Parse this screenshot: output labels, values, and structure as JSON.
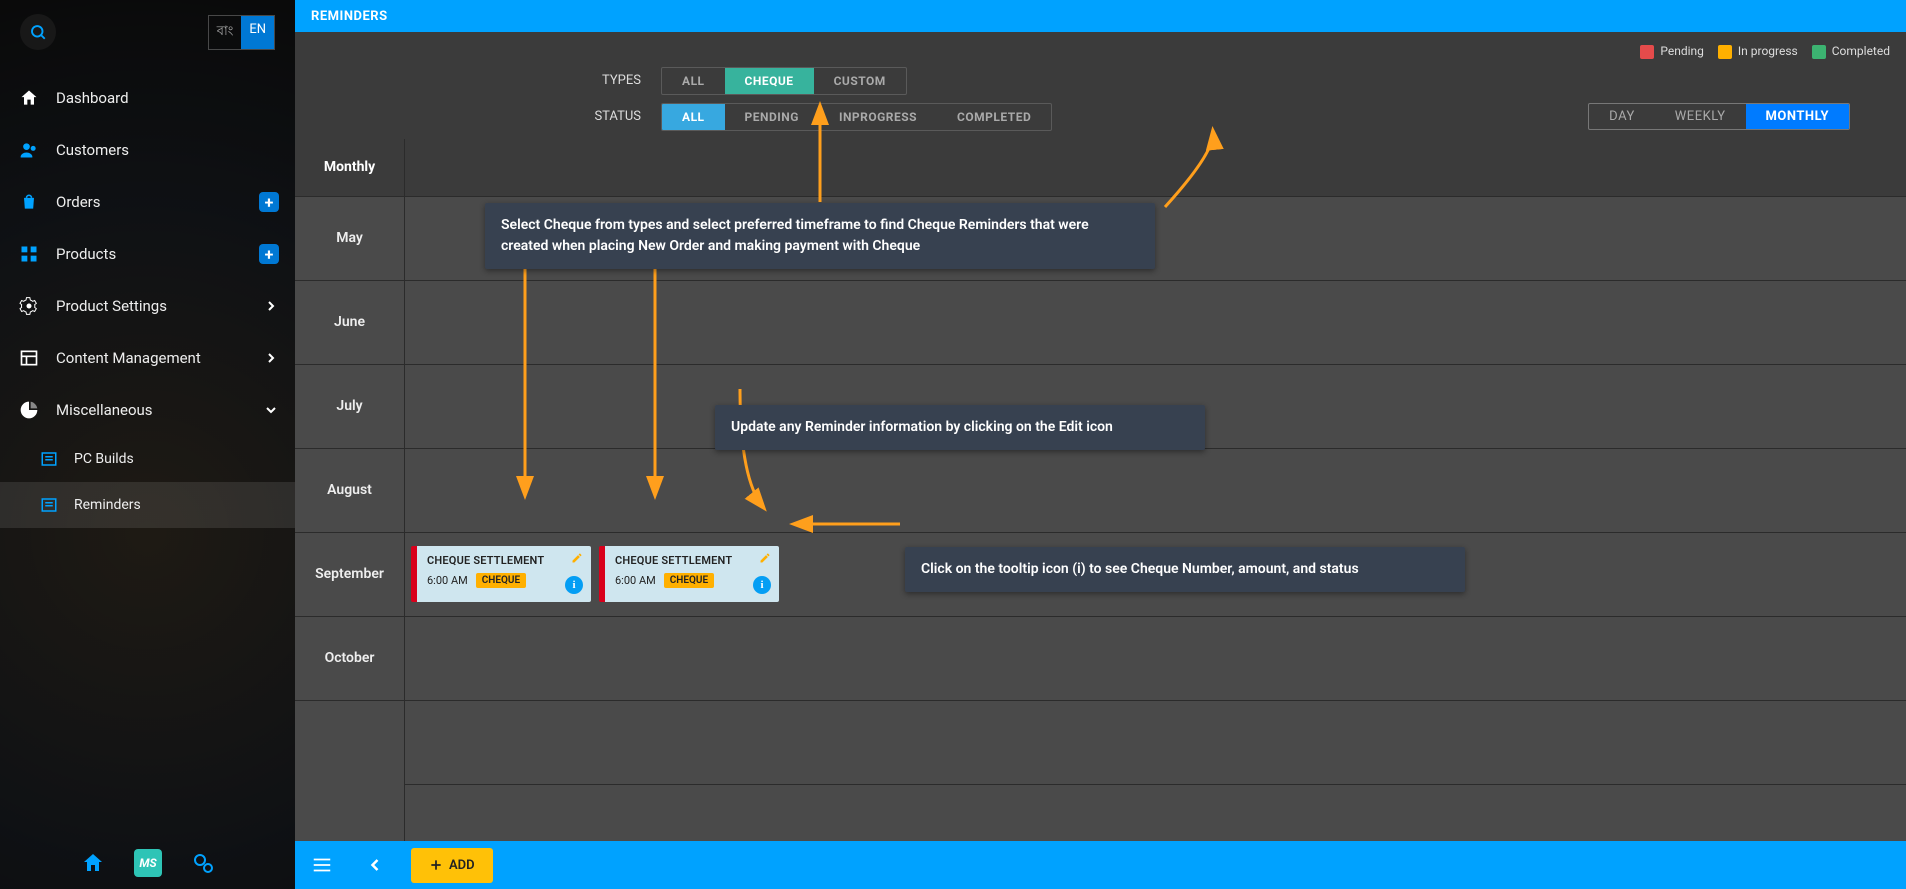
{
  "lang": {
    "alt": "বাং",
    "en": "EN"
  },
  "sidebar": {
    "items": [
      {
        "label": "Dashboard"
      },
      {
        "label": "Customers"
      },
      {
        "label": "Orders"
      },
      {
        "label": "Products"
      },
      {
        "label": "Product Settings"
      },
      {
        "label": "Content Management"
      },
      {
        "label": "Miscellaneous"
      }
    ],
    "subitems": [
      {
        "label": "PC Builds"
      },
      {
        "label": "Reminders"
      }
    ]
  },
  "page": {
    "title": "REMINDERS"
  },
  "legend": {
    "pending": {
      "label": "Pending",
      "color": "#e54b4b"
    },
    "inprogress": {
      "label": "In progress",
      "color": "#ffb000"
    },
    "completed": {
      "label": "Completed",
      "color": "#3cb371"
    }
  },
  "filters": {
    "types_label": "TYPES",
    "types": {
      "all": "ALL",
      "cheque": "CHEQUE",
      "custom": "CUSTOM"
    },
    "status_label": "STATUS",
    "status": {
      "all": "ALL",
      "pending": "PENDING",
      "inprogress": "INPROGRESS",
      "completed": "COMPLETED"
    },
    "view": {
      "day": "DAY",
      "weekly": "WEEKLY",
      "monthly": "MONTHLY"
    }
  },
  "calendar": {
    "head": "Monthly",
    "months": [
      "May",
      "June",
      "July",
      "August",
      "September",
      "October"
    ]
  },
  "cards": [
    {
      "title": "CHEQUE SETTLEMENT",
      "time": "6:00 AM",
      "tag": "CHEQUE"
    },
    {
      "title": "CHEQUE SETTLEMENT",
      "time": "6:00 AM",
      "tag": "CHEQUE"
    }
  ],
  "annotations": {
    "a1": "Select Cheque from types and select preferred timeframe to find Cheque Reminders that were created when placing New Order and making payment with Cheque",
    "a2": "Update any Reminder information by clicking on the Edit icon",
    "a3": "Click on the tooltip icon (i) to see Cheque Number, amount, and status"
  },
  "bottombar": {
    "add": "ADD"
  }
}
